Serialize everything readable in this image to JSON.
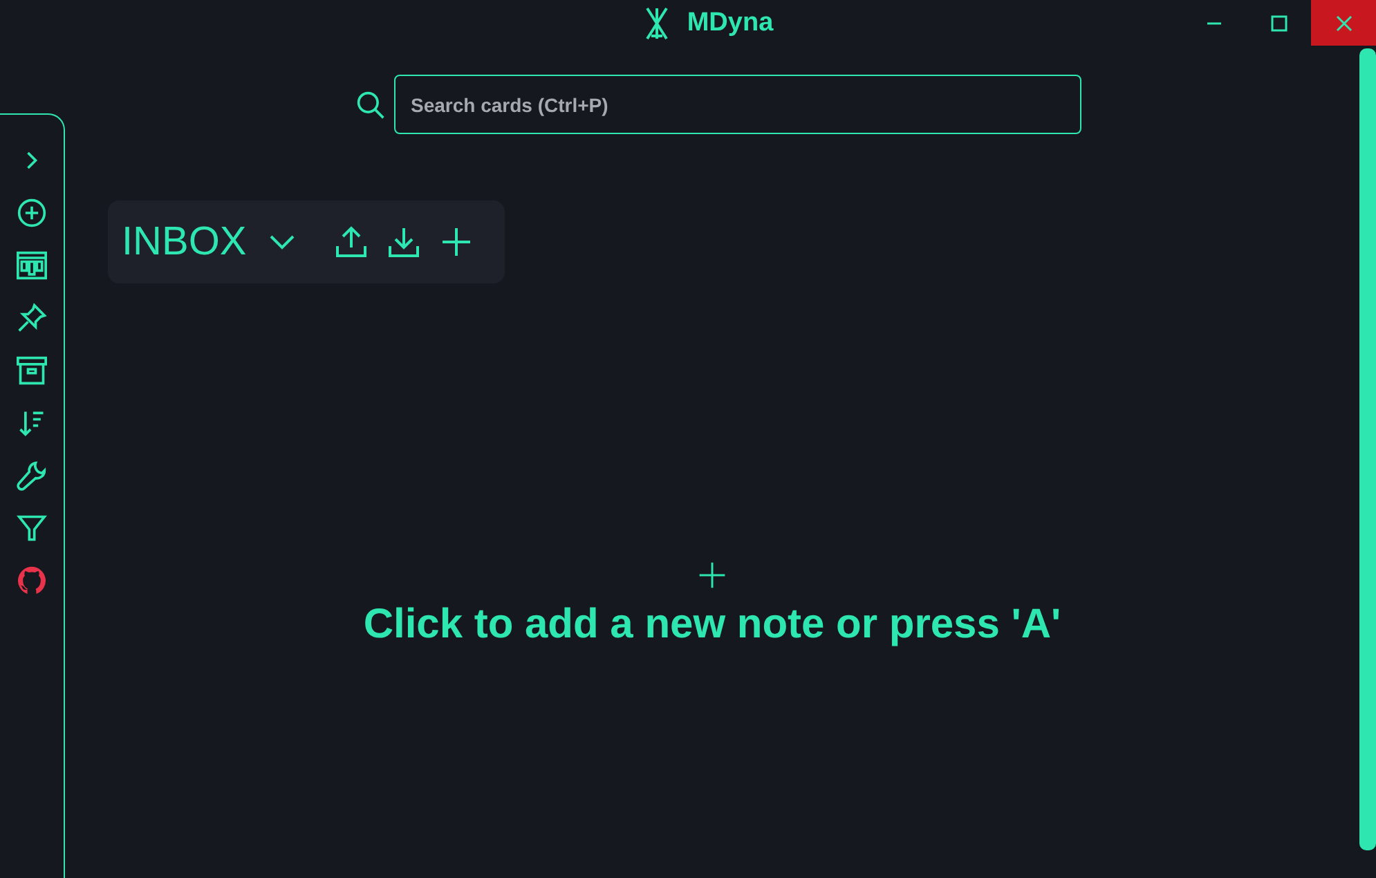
{
  "window": {
    "title": "MDyna"
  },
  "search": {
    "placeholder": "Search cards (Ctrl+P)"
  },
  "board": {
    "title": "INBOX"
  },
  "empty_state": {
    "text": "Click to add a new note or press 'A'"
  }
}
